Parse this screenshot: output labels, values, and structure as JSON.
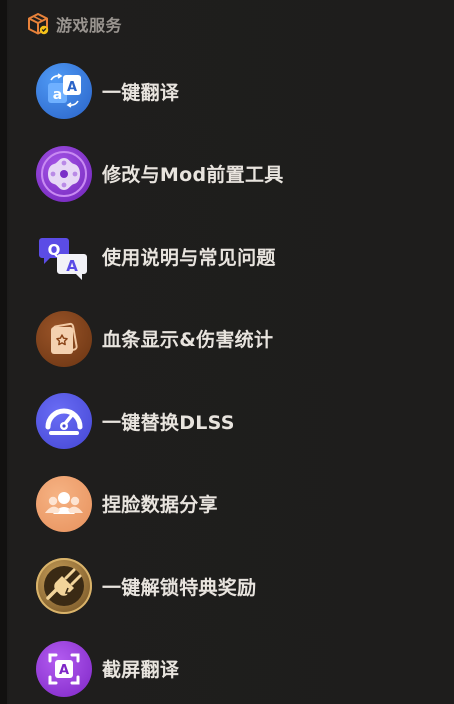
{
  "section": {
    "title": "游戏服务",
    "icon": "game-box-icon"
  },
  "items": [
    {
      "label": "一键翻译",
      "icon": "translate-icon",
      "color": "#3a7fe0"
    },
    {
      "label": "修改与Mod前置工具",
      "icon": "gamepad-icon",
      "color": "#8a3fd0"
    },
    {
      "label": "使用说明与常见问题",
      "icon": "qa-icon",
      "color": "#5a4fe0"
    },
    {
      "label": "血条显示&伤害统计",
      "icon": "card-icon",
      "color": "#8a4a22"
    },
    {
      "label": "一键替换DLSS",
      "icon": "speedometer-icon",
      "color": "#5a5ce8"
    },
    {
      "label": "捏脸数据分享",
      "icon": "people-icon",
      "color": "#f0a070"
    },
    {
      "label": "一键解锁特典奖励",
      "icon": "unlock-plug-icon",
      "color": "#a07a40"
    },
    {
      "label": "截屏翻译",
      "icon": "screenshot-translate-icon",
      "color": "#9a3ed8"
    }
  ]
}
